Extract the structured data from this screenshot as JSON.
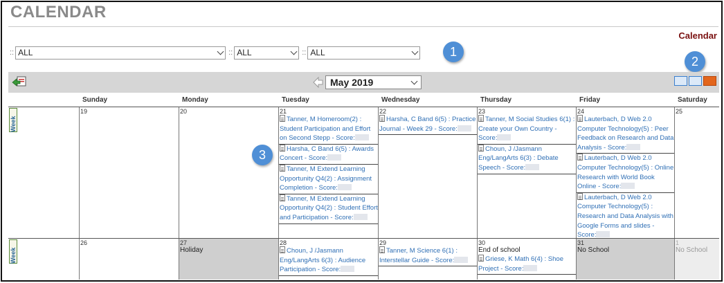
{
  "header": {
    "title": "CALENDAR",
    "calendar_link": "Calendar"
  },
  "filters": {
    "sep": "::",
    "select_1": "ALL",
    "select_2": "ALL",
    "select_3": "ALL"
  },
  "callouts": [
    "1",
    "2",
    "3"
  ],
  "toolbar": {
    "month": "May 2019"
  },
  "weekdays": [
    "Sunday",
    "Monday",
    "Tuesday",
    "Wednesday",
    "Thursday",
    "Friday",
    "Saturday"
  ],
  "week_tab_label": "Week",
  "weeks": [
    {
      "days": [
        {
          "num": "19",
          "events": []
        },
        {
          "num": "20",
          "events": []
        },
        {
          "num": "21",
          "events": [
            "Tanner, M Homeroom(2) : Student Participation and Effort on Second Stepp - Score:",
            "Harsha, C Band 6(5) : Awards Concert - Score:",
            "Tanner, M Extend Learning Opportunity Q4(2) : Assignment Completion - Score:",
            "Tanner, M Extend Learning Opportunity Q4(2) : Student Effort and Participation - Score:"
          ]
        },
        {
          "num": "22",
          "events": [
            "Harsha, C Band 6(5) : Practice Journal - Week 29 - Score:"
          ]
        },
        {
          "num": "23",
          "events": [
            "Tanner, M Social Studies 6(1) : Create your Own Country - Score:",
            "Choun, J /Jasmann Eng/LangArts 6(3) : Debate Speech - Score:"
          ]
        },
        {
          "num": "24",
          "events": [
            "Lauterbach, D Web 2.0 Computer Technology(5) : Peer Feedback on Research and Data Analysis - Score:",
            "Lauterbach, D Web 2.0 Computer Technology(5) : Online Research with World Book Online - Score:",
            "Lauterbach, D Web 2.0 Computer Technology(5) : Research and Data Analysis with Google Forms and slides - Score:"
          ]
        },
        {
          "num": "25",
          "events": []
        }
      ]
    },
    {
      "days": [
        {
          "num": "26",
          "events": []
        },
        {
          "num": "27",
          "note": "Holiday",
          "events": []
        },
        {
          "num": "28",
          "events": [
            "Choun, J /Jasmann Eng/LangArts 6(3) : Audience Participation - Score:"
          ]
        },
        {
          "num": "29",
          "events": [
            "Tanner, M Science 6(1) : Interstellar Guide - Score:"
          ]
        },
        {
          "num": "30",
          "note": "End of school",
          "events": [
            "Griese, K Math 6(4) : Shoe Project - Score:"
          ]
        },
        {
          "num": "31",
          "note": "No School",
          "events": []
        },
        {
          "num": "1",
          "note": "No School",
          "events": []
        }
      ]
    }
  ]
}
